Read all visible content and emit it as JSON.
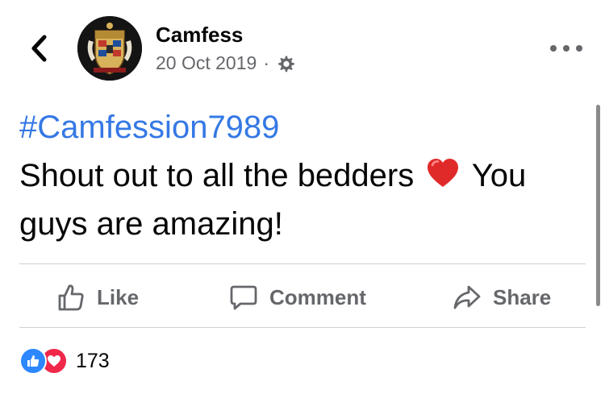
{
  "header": {
    "page_name": "Camfess",
    "date": "20 Oct 2019",
    "separator": "·",
    "audience_icon": "gear-icon"
  },
  "post": {
    "hashtag": "#Camfession7989",
    "text_before_emoji": "Shout out to all the bedders ",
    "emoji": "red-heart",
    "text_after_emoji": " You guys are amazing!"
  },
  "actions": {
    "like_label": "Like",
    "comment_label": "Comment",
    "share_label": "Share"
  },
  "reactions": {
    "types": [
      "like",
      "love"
    ],
    "count": "173"
  },
  "colors": {
    "hashtag": "#3578e5",
    "secondary_text": "#65676b",
    "like_blue": "#2d88ff",
    "love_red": "#f0284a",
    "divider": "#ced0d4"
  }
}
